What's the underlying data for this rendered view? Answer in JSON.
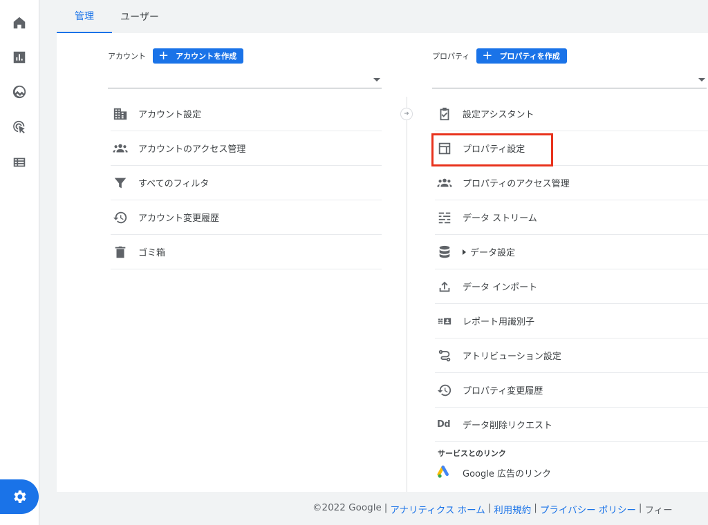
{
  "tabs": [
    {
      "label": "管理"
    },
    {
      "label": "ユーザー"
    }
  ],
  "account": {
    "title": "アカウント",
    "create_label": "アカウントを作成",
    "items": [
      {
        "label": "アカウント設定",
        "icon": "building-icon"
      },
      {
        "label": "アカウントのアクセス管理",
        "icon": "people-icon"
      },
      {
        "label": "すべてのフィルタ",
        "icon": "filter-icon"
      },
      {
        "label": "アカウント変更履歴",
        "icon": "history-icon"
      },
      {
        "label": "ゴミ箱",
        "icon": "trash-icon"
      }
    ]
  },
  "property": {
    "title": "プロパティ",
    "create_label": "プロパティを作成",
    "items": [
      {
        "label": "設定アシスタント",
        "icon": "clipboard-check-icon"
      },
      {
        "label": "プロパティ設定",
        "icon": "layout-icon"
      },
      {
        "label": "プロパティのアクセス管理",
        "icon": "people-icon"
      },
      {
        "label": "データ ストリーム",
        "icon": "streams-icon"
      },
      {
        "label": "データ設定",
        "icon": "database-icon"
      },
      {
        "label": "データ インポート",
        "icon": "upload-icon"
      },
      {
        "label": "レポート用識別子",
        "icon": "identifier-icon"
      },
      {
        "label": "アトリビューション設定",
        "icon": "attribution-icon"
      },
      {
        "label": "プロパティ変更履歴",
        "icon": "history-icon"
      },
      {
        "label": "データ削除リクエスト",
        "icon": "data-deletion-icon",
        "icon_text": "Dd"
      }
    ],
    "section_title": "サービスとのリンク",
    "link_item": {
      "label": "Google 広告のリンク",
      "icon": "google-ads-icon"
    }
  },
  "footer": {
    "copyright": "©2022 Google",
    "links": [
      "アナリティクス ホーム",
      "利用規約",
      "プライバシー ポリシー"
    ],
    "trailing": "フィー"
  },
  "colors": {
    "accent": "#1a73e8",
    "highlight": "#e8321c"
  }
}
